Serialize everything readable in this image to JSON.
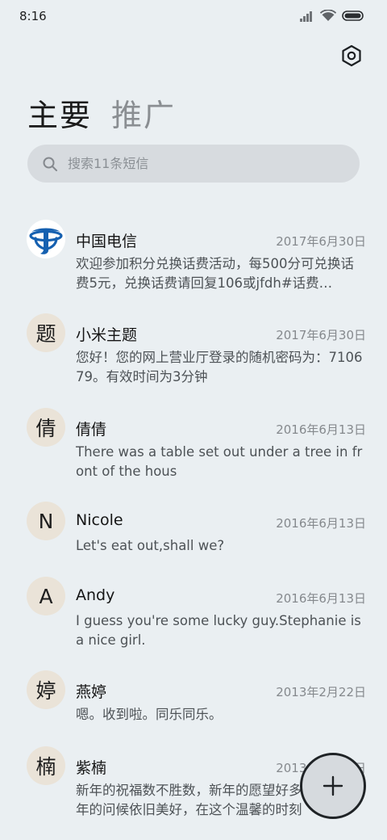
{
  "status_bar": {
    "time": "8:16",
    "icons": [
      "signal-icon",
      "wifi-icon",
      "battery-icon"
    ]
  },
  "header": {
    "settings_icon": "settings-hexagon-icon"
  },
  "tabs": [
    {
      "label": "主要",
      "active": true
    },
    {
      "label": "推广",
      "active": false
    }
  ],
  "search": {
    "placeholder": "搜索11条短信",
    "value": ""
  },
  "conversations": [
    {
      "avatar": "",
      "avatar_icon": "china-telecom-logo",
      "name": "中国电信",
      "date": "2017年6月30日",
      "preview": "欢迎参加积分兑换话费活动，每500分可兑换话费5元，兑换话费请回复106或jfdh#话费…"
    },
    {
      "avatar": "题",
      "name": "小米主题",
      "date": "2017年6月30日",
      "preview": "您好！您的网上营业厅登录的随机密码为：710679。有效时间为3分钟"
    },
    {
      "avatar": "倩",
      "name": "倩倩",
      "date": "2016年6月13日",
      "preview": "There was a table set out under a tree in front of the hous"
    },
    {
      "avatar": "N",
      "name": "Nicole",
      "date": "2016年6月13日",
      "preview": "Let's eat out,shall we?"
    },
    {
      "avatar": "A",
      "name": "Andy",
      "date": "2016年6月13日",
      "preview": "I guess you're some lucky guy.Stephanie is a nice girl."
    },
    {
      "avatar": "婷",
      "name": "燕婷",
      "date": "2013年2月22日",
      "preview": "嗯。收到啦。同乐同乐。"
    },
    {
      "avatar": "楠",
      "name": "紫楠",
      "date": "2013年2月22日",
      "preview": "新年的祝福数不胜数，新年的愿望好多好多，新年的问候依旧美好，在这个温馨的时刻"
    }
  ],
  "fab": {
    "icon": "plus-icon"
  },
  "colors": {
    "background": "#eaeff2",
    "search_bg": "#d7dbdf",
    "avatar_bg": "#eae3d8",
    "telecom_blue": "#1560b0"
  }
}
